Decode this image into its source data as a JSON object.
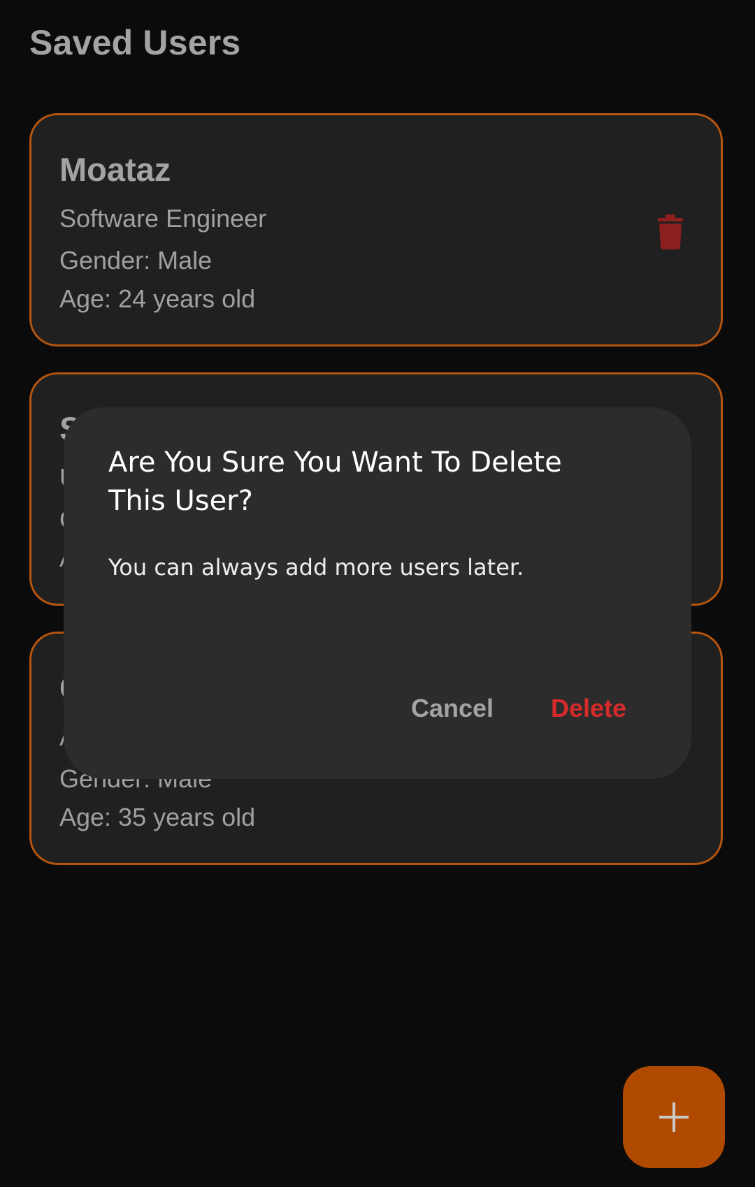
{
  "header": {
    "title": "Saved Users"
  },
  "users": [
    {
      "name": "Moataz",
      "occupation": "Software Engineer",
      "gender": "Gender: Male",
      "age": "Age: 24 years old"
    },
    {
      "name": "S",
      "occupation": "U",
      "gender": "G",
      "age": "A"
    },
    {
      "name": "C",
      "occupation": "A",
      "gender": "Gender: Male",
      "age": "Age: 35 years old"
    }
  ],
  "dialog": {
    "title": "Are You Sure You Want To Delete This User?",
    "message": "You can always add more users later.",
    "cancel_label": "Cancel",
    "confirm_label": "Delete"
  },
  "fab": {
    "icon": "plus-icon"
  },
  "colors": {
    "background": "#0b0b0b",
    "card": "#202020",
    "accent": "#b5550e",
    "fab": "#b04a00",
    "danger": "#d62b2b",
    "delete_icon": "#8e1f1f",
    "dialog": "#2c2c2c"
  }
}
